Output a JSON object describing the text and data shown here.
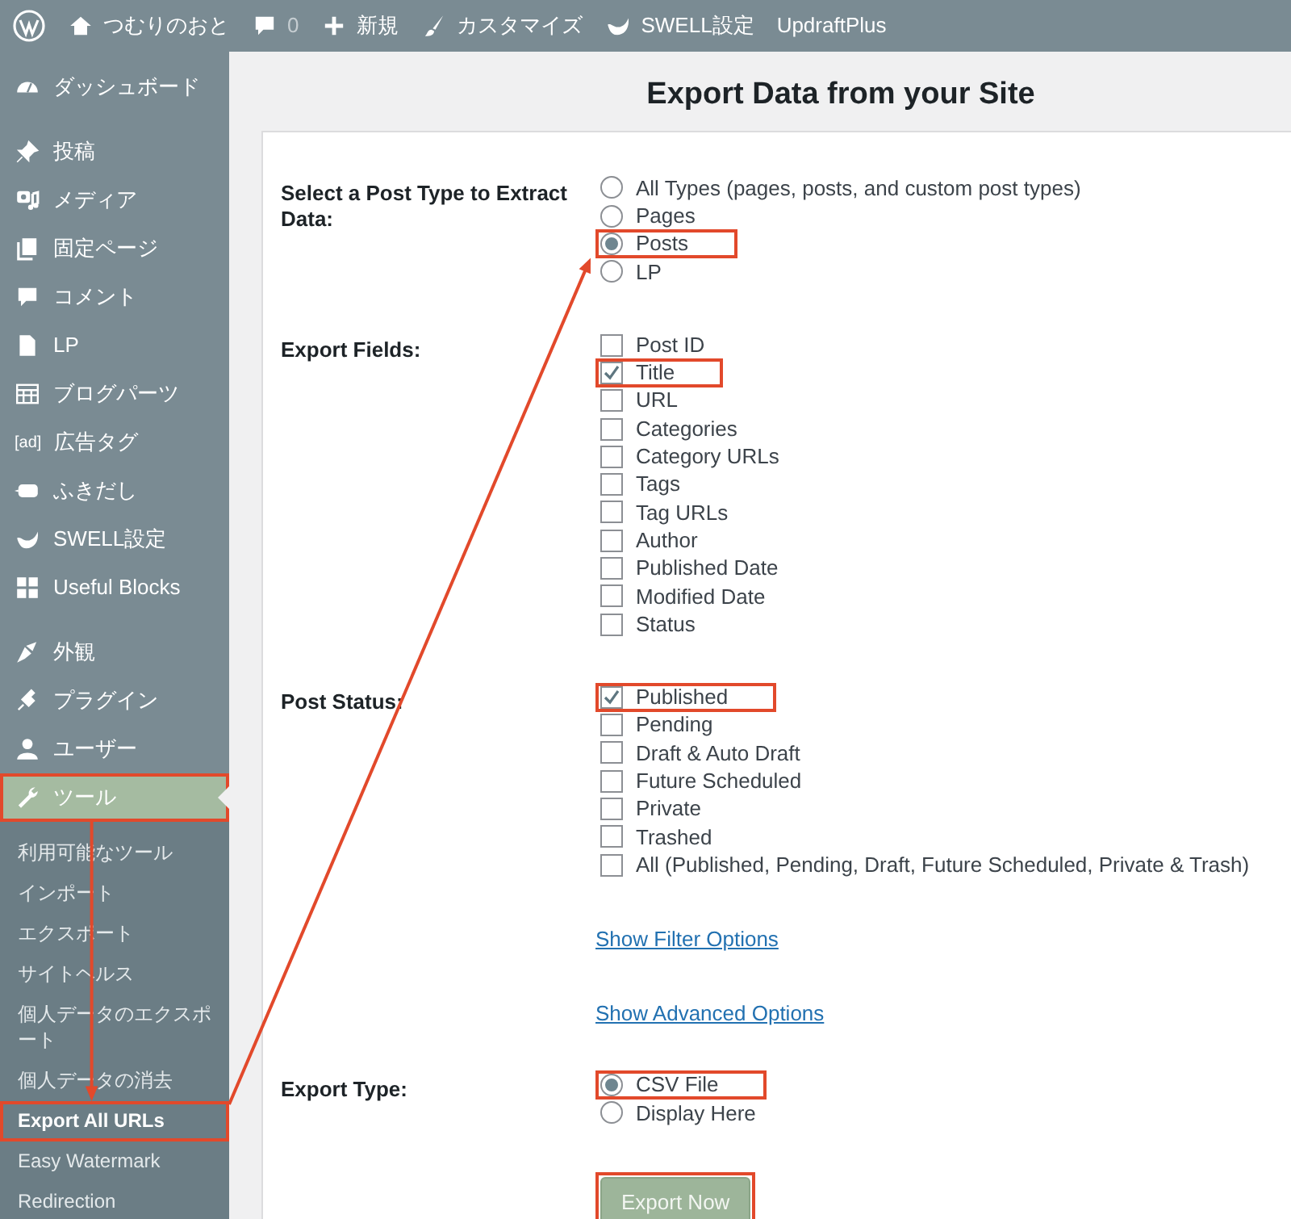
{
  "admin_bar": {
    "items": [
      {
        "kind": "wp-logo"
      },
      {
        "kind": "home",
        "label": "つむりのおと"
      },
      {
        "kind": "comments",
        "label": "0"
      },
      {
        "kind": "new",
        "label": "新規"
      },
      {
        "kind": "customize",
        "label": "カスタマイズ"
      },
      {
        "kind": "swell",
        "label": "SWELL設定"
      },
      {
        "kind": "text",
        "label": "UpdraftPlus"
      }
    ]
  },
  "sidebar": {
    "items": [
      {
        "kind": "item",
        "label": "ダッシュボード",
        "current": false,
        "highlighted": false
      },
      {
        "kind": "separator"
      },
      {
        "kind": "item",
        "label": "投稿",
        "current": false,
        "highlighted": false
      },
      {
        "kind": "item",
        "label": "メディア",
        "current": false,
        "highlighted": false
      },
      {
        "kind": "item",
        "label": "固定ページ",
        "current": false,
        "highlighted": false
      },
      {
        "kind": "item",
        "label": "コメント",
        "current": false,
        "highlighted": false
      },
      {
        "kind": "item",
        "label": "LP",
        "current": false,
        "highlighted": false
      },
      {
        "kind": "item",
        "label": "ブログパーツ",
        "current": false,
        "highlighted": false
      },
      {
        "kind": "item",
        "icon_text": "[ad]",
        "label": "広告タグ",
        "current": false,
        "highlighted": false
      },
      {
        "kind": "item",
        "label": "ふきだし",
        "current": false,
        "highlighted": false
      },
      {
        "kind": "item",
        "label": "SWELL設定",
        "current": false,
        "highlighted": false
      },
      {
        "kind": "item",
        "label": "Useful Blocks",
        "current": false,
        "highlighted": false
      },
      {
        "kind": "separator"
      },
      {
        "kind": "item",
        "label": "外観",
        "current": false,
        "highlighted": false
      },
      {
        "kind": "item",
        "label": "プラグイン",
        "current": false,
        "highlighted": false
      },
      {
        "kind": "item",
        "label": "ユーザー",
        "current": false,
        "highlighted": false
      },
      {
        "kind": "item",
        "label": "ツール",
        "current": true,
        "highlighted": true,
        "points_to_next_mark": true,
        "submenu": [
          {
            "label": "利用可能なツール",
            "current": false,
            "highlighted": false
          },
          {
            "label": "インポート",
            "current": false,
            "highlighted": false
          },
          {
            "label": "エクスポート",
            "current": false,
            "highlighted": false
          },
          {
            "label": "サイトヘルス",
            "current": false,
            "highlighted": false
          },
          {
            "label": "個人データのエクスポート",
            "current": false,
            "highlighted": false
          },
          {
            "label": "個人データの消去",
            "current": false,
            "highlighted": false
          },
          {
            "label": "Export All URLs",
            "current": true,
            "highlighted": true,
            "points_to_next_mark": true
          },
          {
            "label": "Easy Watermark",
            "current": false,
            "highlighted": false
          },
          {
            "label": "Redirection",
            "current": false,
            "highlighted": false
          }
        ]
      }
    ]
  },
  "main": {
    "title": "Export Data from your Site",
    "sections": [
      {
        "kind": "radio",
        "label": "Select a Post Type to Extract Data:",
        "options": [
          {
            "label": "All Types (pages, posts, and custom post types)",
            "selected": false,
            "highlighted": false
          },
          {
            "label": "Pages",
            "selected": false,
            "highlighted": false
          },
          {
            "label": "Posts",
            "selected": true,
            "highlighted": true
          },
          {
            "label": "LP",
            "selected": false,
            "highlighted": false
          }
        ]
      },
      {
        "kind": "checkbox",
        "label": "Export Fields:",
        "options": [
          {
            "label": "Post ID",
            "checked": false,
            "highlighted": false
          },
          {
            "label": "Title",
            "checked": true,
            "highlighted": true
          },
          {
            "label": "URL",
            "checked": false,
            "highlighted": false
          },
          {
            "label": "Categories",
            "checked": false,
            "highlighted": false
          },
          {
            "label": "Category URLs",
            "checked": false,
            "highlighted": false
          },
          {
            "label": "Tags",
            "checked": false,
            "highlighted": false
          },
          {
            "label": "Tag URLs",
            "checked": false,
            "highlighted": false
          },
          {
            "label": "Author",
            "checked": false,
            "highlighted": false
          },
          {
            "label": "Published Date",
            "checked": false,
            "highlighted": false
          },
          {
            "label": "Modified Date",
            "checked": false,
            "highlighted": false
          },
          {
            "label": "Status",
            "checked": false,
            "highlighted": false
          }
        ]
      },
      {
        "kind": "checkbox",
        "label": "Post Status:",
        "options": [
          {
            "label": "Published",
            "checked": true,
            "highlighted": true
          },
          {
            "label": "Pending",
            "checked": false,
            "highlighted": false
          },
          {
            "label": "Draft & Auto Draft",
            "checked": false,
            "highlighted": false
          },
          {
            "label": "Future Scheduled",
            "checked": false,
            "highlighted": false
          },
          {
            "label": "Private",
            "checked": false,
            "highlighted": false
          },
          {
            "label": "Trashed",
            "checked": false,
            "highlighted": false
          },
          {
            "label": "All (Published, Pending, Draft, Future Scheduled, Private & Trash)",
            "checked": false,
            "highlighted": false
          }
        ]
      },
      {
        "kind": "link",
        "label": "Show Filter Options"
      },
      {
        "kind": "link",
        "label": "Show Advanced Options"
      },
      {
        "kind": "radio",
        "label": "Export Type:",
        "options": [
          {
            "label": "CSV File",
            "selected": true,
            "highlighted": true
          },
          {
            "label": "Display Here",
            "selected": false,
            "highlighted": false
          }
        ]
      },
      {
        "kind": "button",
        "label": "Export Now",
        "highlighted": true
      }
    ]
  }
}
